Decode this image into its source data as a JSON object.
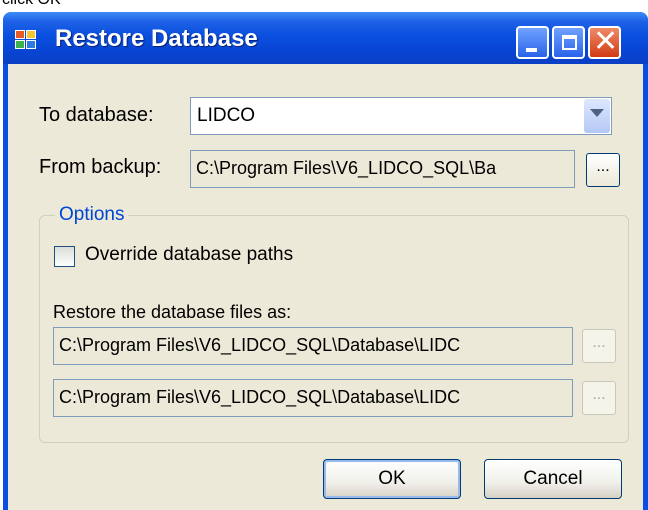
{
  "top_caption": "click OK",
  "window": {
    "title": "Restore Database",
    "controls": {
      "minimize": "minimize",
      "maximize": "maximize",
      "close": "close"
    }
  },
  "form": {
    "to_database_label": "To database:",
    "to_database_value": "LIDCO",
    "from_backup_label": "From backup:",
    "from_backup_value": "C:\\Program Files\\V6_LIDCO_SQL\\Ba",
    "browse_label": "..."
  },
  "options": {
    "legend": "Options",
    "override_label": "Override database paths",
    "override_checked": false,
    "restore_files_label": "Restore the database files as:",
    "files": [
      {
        "path": "C:\\Program Files\\V6_LIDCO_SQL\\Database\\LIDC",
        "browse_label": "..."
      },
      {
        "path": "C:\\Program Files\\V6_LIDCO_SQL\\Database\\LIDC",
        "browse_label": "..."
      }
    ]
  },
  "buttons": {
    "ok": "OK",
    "cancel": "Cancel"
  },
  "colors": {
    "titlebar": "#0a4fdf",
    "client": "#ece9d8",
    "group_legend": "#0046d5",
    "close_button": "#d13b13"
  },
  "icons": {
    "app": "restore-database-app-icon",
    "dropdown": "chevron-down-icon"
  }
}
